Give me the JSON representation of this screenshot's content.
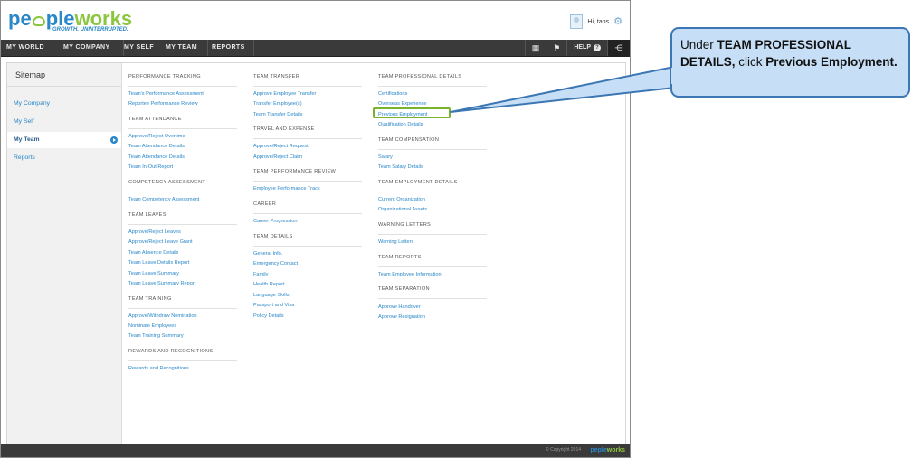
{
  "header": {
    "logo_text_blue_1": "pe",
    "logo_text_blue_2": "ple",
    "logo_text_green": "works",
    "tagline": "GROWTH. UNINTERRUPTED.",
    "greeting": "Hi, tans"
  },
  "nav": {
    "items": [
      "MY WORLD",
      "MY COMPANY",
      "MY SELF",
      "MY TEAM",
      "REPORTS"
    ],
    "help": "HELP",
    "help_icon": "?"
  },
  "sidebar": {
    "title": "Sitemap",
    "items": [
      "My Company",
      "My Self",
      "My Team",
      "Reports"
    ],
    "active": "My Team"
  },
  "columns": {
    "col1": {
      "performance_tracking": {
        "header": "PERFORMANCE TRACKING",
        "links": [
          "Team's Performance Assessment",
          "Reportee Performance Review"
        ]
      },
      "team_attendance": {
        "header": "TEAM ATTENDANCE",
        "links": [
          "Approve/Reject Overtime",
          "Team Attendance Details",
          "Team Attendance Details",
          "Team In-Out Report"
        ]
      },
      "competency_assessment": {
        "header": "COMPETENCY ASSESSMENT",
        "links": [
          "Team Competency Assessment"
        ]
      },
      "team_leaves": {
        "header": "TEAM LEAVES",
        "links": [
          "Approve/Reject Leaves",
          "Approve/Reject Leave Grant",
          "Team Absence Details",
          "Team Leave Details Report",
          "Team Leave Summary",
          "Team Leave Summary Report"
        ]
      },
      "team_training": {
        "header": "TEAM TRAINING",
        "links": [
          "Approve/Withdraw Nomination",
          "Nominate Employees",
          "Team Training Summary"
        ]
      },
      "rewards": {
        "header": "REWARDS AND RECOGNITIONS",
        "links": [
          "Rewards and Recognitions"
        ]
      }
    },
    "col2": {
      "team_transfer": {
        "header": "TEAM TRANSFER",
        "links": [
          "Approve Employee Transfer",
          "Transfer Employee(s)",
          "Team Transfer Details"
        ]
      },
      "travel_expense": {
        "header": "TRAVEL AND EXPENSE",
        "links": [
          "Approve/Reject Request",
          "Approve/Reject Claim"
        ]
      },
      "team_performance_review": {
        "header": "TEAM PERFORMANCE REVIEW",
        "links": [
          "Employee Performance Track"
        ]
      },
      "career": {
        "header": "CAREER",
        "links": [
          "Career Progression"
        ]
      },
      "team_details": {
        "header": "TEAM DETAILS",
        "links": [
          "General Info.",
          "Emergency Contact",
          "Family",
          "Health Report",
          "Language Skills",
          "Passport and Visa",
          "Policy Details"
        ]
      }
    },
    "col3": {
      "team_professional_details": {
        "header": "TEAM PROFESSIONAL DETAILS",
        "links": [
          "Certifications",
          "Overseas Experience",
          "Previous Employment",
          "Qualification Details"
        ]
      },
      "team_compensation": {
        "header": "TEAM COMPENSATION",
        "links": [
          "Salary",
          "Team Salary Details"
        ]
      },
      "team_employment_details": {
        "header": "TEAM EMPLOYMENT DETAILS",
        "links": [
          "Current Organization",
          "Organizational Assets"
        ]
      },
      "warning_letters": {
        "header": "WARNING LETTERS",
        "links": [
          "Warning Letters"
        ]
      },
      "team_reports": {
        "header": "TEAM REPORTS",
        "links": [
          "Team Employee Information"
        ]
      },
      "team_separation": {
        "header": "TEAM SEPARATION",
        "links": [
          "Approve Handover",
          "Approve Resignation"
        ]
      }
    }
  },
  "footer": {
    "copyright": "© Copyright 2014",
    "logo_blue": "peple",
    "logo_green": "works"
  },
  "callout": {
    "text_1": "Under ",
    "bold_1": "TEAM PROFESSIONAL DETAILS,",
    "text_2": " click ",
    "bold_2": "Previous Employment."
  },
  "colors": {
    "brand_blue": "#2a87c8",
    "brand_green": "#8cc63f",
    "nav_bg": "#3a3a3a",
    "callout_fill": "#c6def6",
    "callout_border": "#3c77b4",
    "highlight_border": "#7ab22e"
  }
}
